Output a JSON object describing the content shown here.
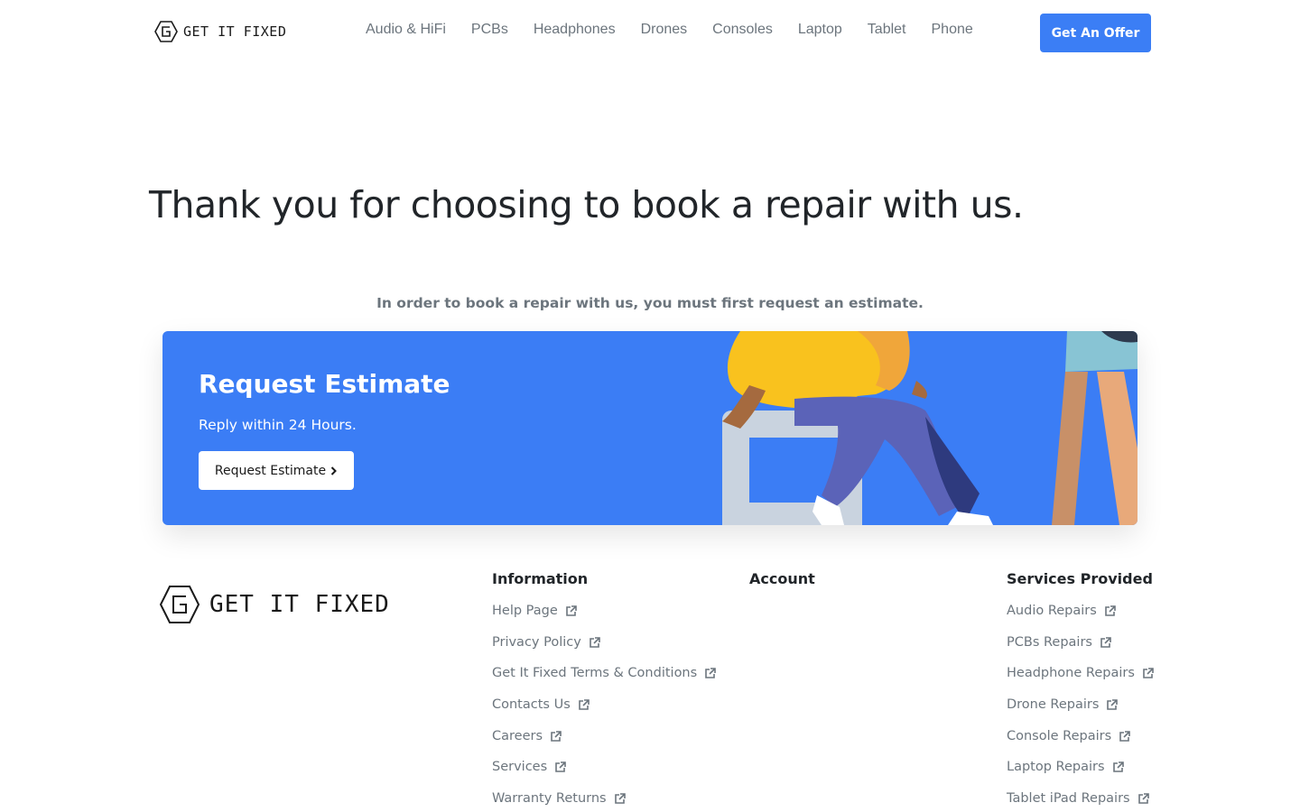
{
  "header": {
    "logo_text": "GET IT FIXED",
    "nav": [
      "Audio & HiFi",
      "PCBs",
      "Headphones",
      "Drones",
      "Consoles",
      "Laptop",
      "Tablet",
      "Phone"
    ],
    "offer_button": "Get An Offer"
  },
  "hero": {
    "title": "Thank you for choosing to book a repair with us.",
    "subtitle": "In order to book a repair with us, you must first request an estimate."
  },
  "banner": {
    "title": "Request Estimate",
    "subtitle": "Reply within 24 Hours.",
    "button_label": "Request Estimate",
    "button_icon": "chevron-right-icon"
  },
  "footer": {
    "logo_text": "GET IT FIXED",
    "information": {
      "heading": "Information",
      "links": [
        "Help Page",
        "Privacy Policy",
        "Get It Fixed Terms & Conditions",
        "Contacts Us",
        "Careers",
        "Services",
        "Warranty Returns"
      ]
    },
    "account": {
      "heading": "Account"
    },
    "services": {
      "heading": "Services Provided",
      "links": [
        "Audio Repairs",
        "PCBs Repairs",
        "Headphone Repairs",
        "Drone Repairs",
        "Console Repairs",
        "Laptop Repairs",
        "Tablet iPad Repairs"
      ]
    },
    "link_icon": "external-link-icon"
  },
  "colors": {
    "accent": "#3b7ef5",
    "text_muted": "#6c757d",
    "text_dark": "#212529"
  }
}
